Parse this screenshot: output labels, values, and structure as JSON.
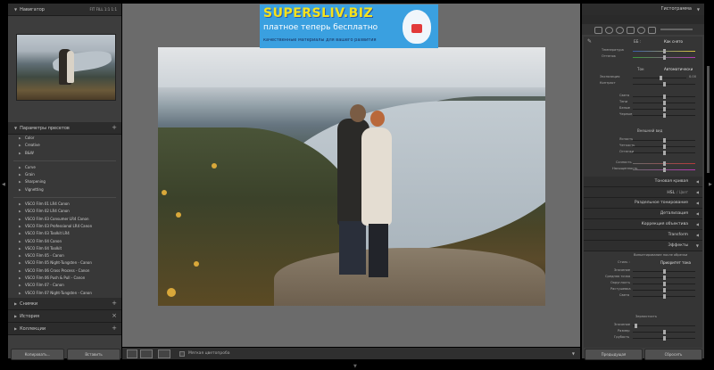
{
  "banner": {
    "brand": "SUPERSLIV.BIZ",
    "tagline": "платное теперь бесплатно",
    "subtitle": "качественные материалы для вашего развития"
  },
  "left_panel": {
    "navigator_title": "Навигатор",
    "navigator_zoom_options": "FIT  FILL  1:1  1:1",
    "presets_title": "Параметры пресетов",
    "preset_groups_a": [
      "Color",
      "Creative",
      "B&W"
    ],
    "preset_groups_b": [
      "Curve",
      "Grain",
      "Sharpening",
      "Vignetting"
    ],
    "vsco_presets": [
      "VSCO Film 01 LR4 Canon",
      "VSCO Film 02 LR4 Canon",
      "VSCO Film 03 Consumer LR4 Canon",
      "VSCO Film 03 Professional LR4 Canon",
      "VSCO Film 03 Toolkit LR4",
      "VSCO Film 04 Canon",
      "VSCO Film 04 Toolkit",
      "VSCO Film 05 - Canon",
      "VSCO Film 05 Night-Tungsten - Canon",
      "VSCO Film 06 Cross Process - Canon",
      "VSCO Film 06 Push & Pull - Canon",
      "VSCO Film 07 - Canon",
      "VSCO Film 07 Night-Tungsten - Canon"
    ],
    "snapshots_title": "Снимки",
    "history_title": "История",
    "collections_title": "Коллекции",
    "copy_button": "Копировать...",
    "paste_button": "Вставить"
  },
  "toolbar": {
    "soft_proofing": "Мягкая цветопроба"
  },
  "right_panel": {
    "histogram_title": "Гистограмма",
    "wb_label": "ББ :",
    "wb_value": "Как снято",
    "temperature": "Температура",
    "tint": "Оттенок",
    "tone_label": "Тон",
    "tone_auto": "Автоматически",
    "exposure": "Экспозиция",
    "exposure_value": "0.00",
    "contrast": "Контраст",
    "highlights": "Света",
    "shadows": "Тени",
    "whites": "Белые",
    "blacks": "Черные",
    "presence_label": "Внешний вид",
    "clarity": "Ясность",
    "vibrance": "Четкость",
    "dehaze": "Оттенки",
    "saturation": "Сочность",
    "saturation2": "Насыщенность",
    "panel_tone_curve": "Тоновая кривая",
    "panel_hsl": "HSL",
    "panel_hsl_sub": "/ Цвет",
    "panel_split_toning": "Раздельное тонирование",
    "panel_detail": "Детализация",
    "panel_lens": "Коррекция объектива",
    "panel_transform": "Transform",
    "panel_effects": "Эффекты",
    "vignette_title": "Виньетирование после обрезки",
    "vignette_style_label": "Стиль :",
    "vignette_style_value": "Приоритет тона",
    "vig_amount": "Значение",
    "vig_midpoint": "Средняя точка",
    "vig_roundness": "Округлость",
    "vig_feather": "Растушевка",
    "vig_highlights": "Света",
    "grain_title": "Зернистость",
    "grain_amount": "Значение",
    "grain_size": "Размер",
    "grain_roughness": "Грубость",
    "previous_button": "Предыдущая",
    "reset_button": "Сбросить"
  },
  "colors": {
    "panel_bg": "#3d3d3d",
    "canvas_bg": "#6b6b6b",
    "banner_bg": "#3aa0e0",
    "banner_brand": "#f5e21c"
  }
}
